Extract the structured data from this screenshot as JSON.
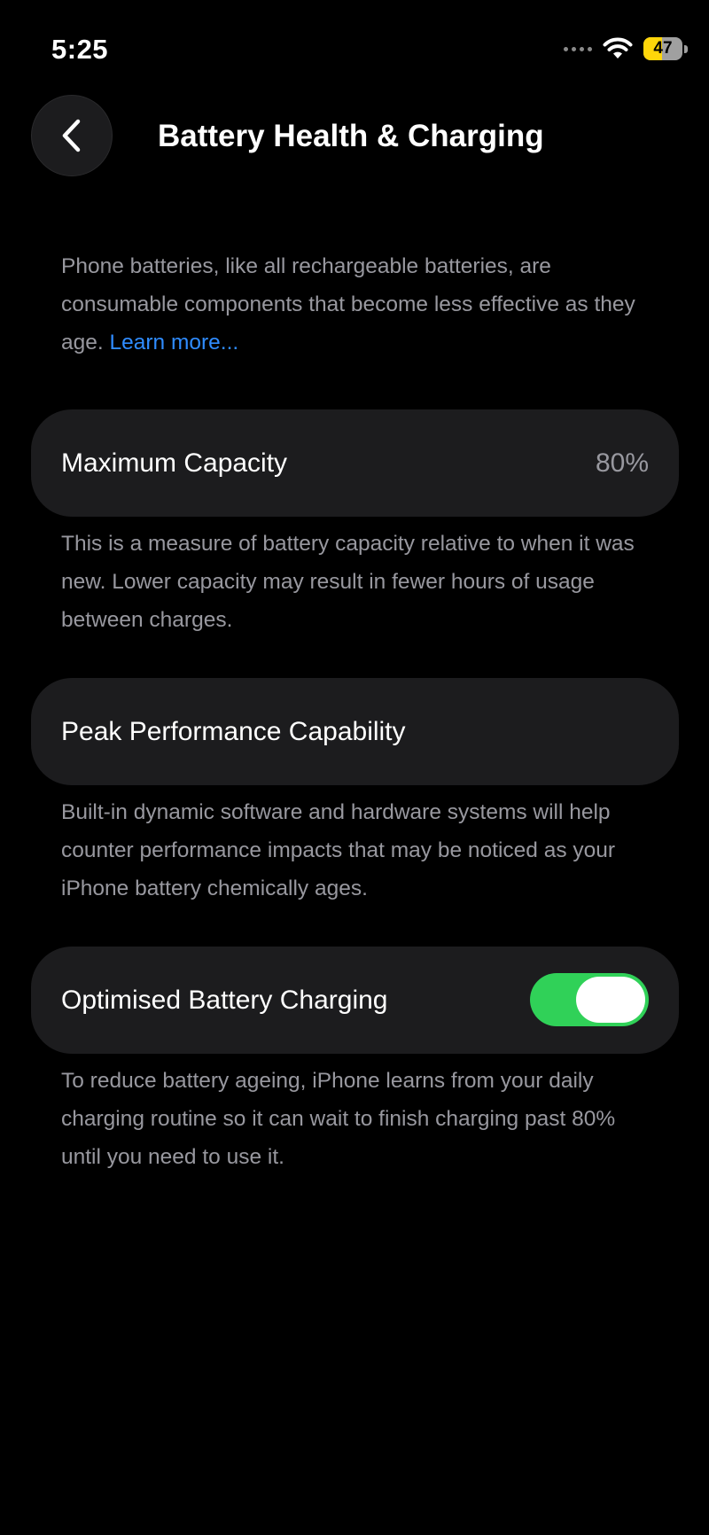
{
  "status_bar": {
    "time": "5:25",
    "battery_level": "47",
    "battery_fraction": 0.47,
    "icons": [
      "signal-dots-icon",
      "wifi-icon",
      "battery-icon"
    ],
    "battery_color": "#ffd60a"
  },
  "header": {
    "title": "Battery Health & Charging",
    "back_icon": "chevron-left-icon"
  },
  "intro": {
    "text": "Phone batteries, like all rechargeable batteries, are consumable components that become less effective as they age. ",
    "link": "Learn more..."
  },
  "sections": {
    "max_capacity": {
      "label": "Maximum Capacity",
      "value": "80%",
      "description": "This is a measure of battery capacity relative to when it was new. Lower capacity may result in fewer hours of usage between charges."
    },
    "peak_performance": {
      "label": "Peak Performance Capability",
      "description": "Built-in dynamic software and hardware systems will help counter performance impacts that may be noticed as your iPhone battery chemically ages."
    },
    "optimised_charging": {
      "label": "Optimised Battery Charging",
      "enabled": true,
      "description": "To reduce battery ageing, iPhone learns from your daily charging routine so it can wait to finish charging past 80% until you need to use it."
    }
  },
  "colors": {
    "background": "#000000",
    "card": "#1c1c1e",
    "secondary_text": "#98989f",
    "link": "#2f8cff",
    "toggle_on": "#30d158"
  }
}
